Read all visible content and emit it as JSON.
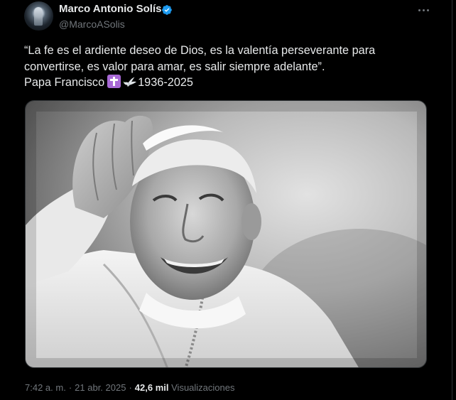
{
  "tweet": {
    "author_name": "Marco Antonio Solís",
    "handle": "@MarcoASolis",
    "verified": true,
    "text_lines": [
      "“La fe es el ardiente deseo de Dios, es la valentía perseverante para",
      "convertirse, es valor para amar, es salir siempre adelante”."
    ],
    "sign_prefix": "Papa Francisco",
    "sign_emojis": [
      "cross-emoji",
      "dove-emoji"
    ],
    "sign_years": "1936-2025",
    "time": "7:42 a. m.",
    "separator": "·",
    "date": "21 abr. 2025",
    "views_count": "42,6 mil",
    "views_label": "Visualizaciones"
  },
  "colors": {
    "background": "#000000",
    "text": "#e7e9ea",
    "muted": "#71767b",
    "verified": "#1d9bf0"
  }
}
